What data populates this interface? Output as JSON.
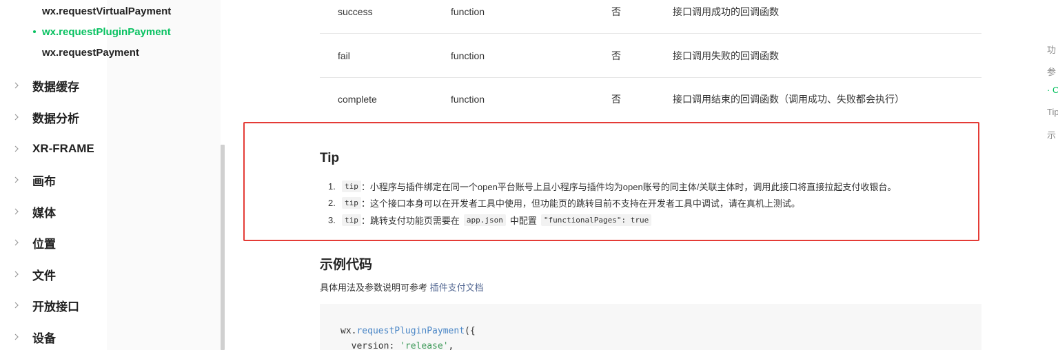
{
  "sidebar": {
    "sub_items": [
      {
        "label": "wx.requestVirtualPayment",
        "active": false
      },
      {
        "label": "wx.requestPluginPayment",
        "active": true
      },
      {
        "label": "wx.requestPayment",
        "active": false
      }
    ],
    "groups": [
      {
        "label": "数据缓存"
      },
      {
        "label": "数据分析"
      },
      {
        "label": "XR-FRAME"
      },
      {
        "label": "画布"
      },
      {
        "label": "媒体"
      },
      {
        "label": "位置"
      },
      {
        "label": "文件"
      },
      {
        "label": "开放接口"
      },
      {
        "label": "设备"
      }
    ]
  },
  "params_table": {
    "rows": [
      {
        "name": "success",
        "type": "function",
        "required": "否",
        "desc": "接口调用成功的回调函数"
      },
      {
        "name": "fail",
        "type": "function",
        "required": "否",
        "desc": "接口调用失败的回调函数"
      },
      {
        "name": "complete",
        "type": "function",
        "required": "否",
        "desc": "接口调用结束的回调函数（调用成功、失败都会执行）"
      }
    ]
  },
  "tip": {
    "title": "Tip",
    "items": [
      {
        "num": "1.",
        "tag": "tip",
        "text": "：小程序与插件绑定在同一个open平台账号上且小程序与插件均为open账号的同主体/关联主体时，调用此接口将直接拉起支付收银台。"
      },
      {
        "num": "2.",
        "tag": "tip",
        "text": "：这个接口本身可以在开发者工具中使用，但功能页的跳转目前不支持在开发者工具中调试，请在真机上测试。"
      },
      {
        "num": "3.",
        "tag": "tip",
        "text": "：跳转支付功能页需要在",
        "code1": "app.json",
        "mid": "中配置",
        "code2": "\"functionalPages\": true"
      }
    ]
  },
  "example": {
    "title": "示例代码",
    "desc": "具体用法及参数说明可参考",
    "link": "插件支付文档",
    "code_lines": [
      {
        "prefix": "wx.",
        "fn": "requestPluginPayment",
        "suffix": "({"
      },
      {
        "prefix": "  version: ",
        "str": "'release'",
        "suffix": ","
      }
    ]
  },
  "toc": {
    "items": [
      {
        "label": "功",
        "active": false
      },
      {
        "label": "参",
        "active": false
      },
      {
        "label": "· C",
        "active": true
      },
      {
        "label": "Tip",
        "active": false
      },
      {
        "label": "示",
        "active": false
      }
    ]
  },
  "colors": {
    "accent": "#07c160",
    "highlight_border": "#e43b36",
    "link": "#576b95"
  }
}
